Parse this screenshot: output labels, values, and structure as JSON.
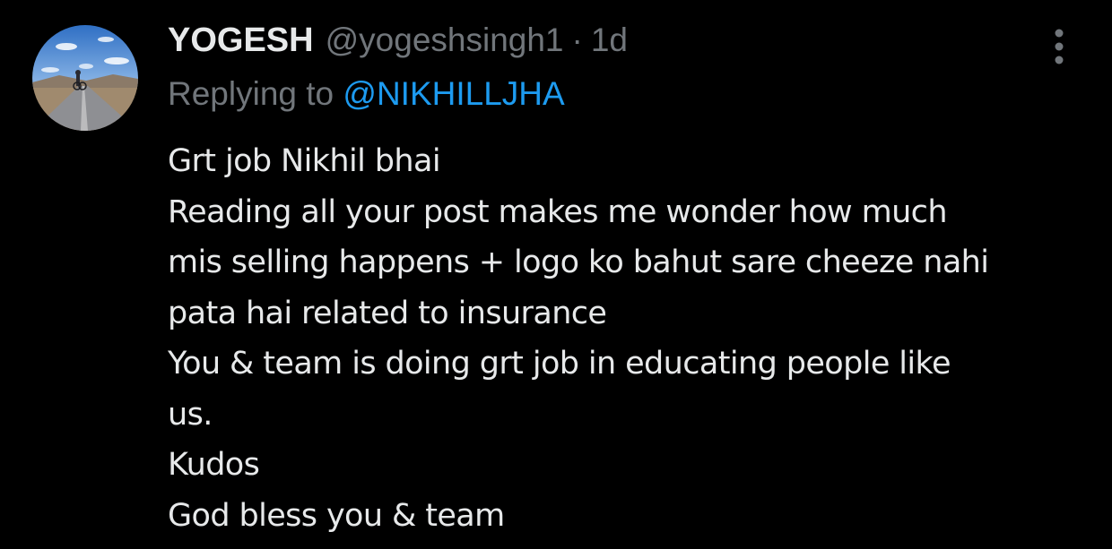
{
  "tweet": {
    "display_name": "YOGESH",
    "handle": "@yogeshsingh1",
    "separator": "·",
    "time": "1d",
    "replying_prefix": "Replying to ",
    "replying_to": "@NIKHILLJHA",
    "lines": [
      "Grt job Nikhil bhai",
      "Reading all your post makes me wonder how much",
      "mis selling happens + logo ko bahut sare cheeze nahi",
      "pata hai related to insurance",
      "You & team is doing grt job in educating people like",
      "us.",
      "Kudos",
      "God bless you & team"
    ]
  },
  "icons": {
    "avatar": "avatar-road-landscape",
    "more": "more-vertical-icon"
  },
  "colors": {
    "background": "#000000",
    "primary_text": "#e7e9ea",
    "secondary_text": "#71767b",
    "link": "#1d9bf0"
  }
}
